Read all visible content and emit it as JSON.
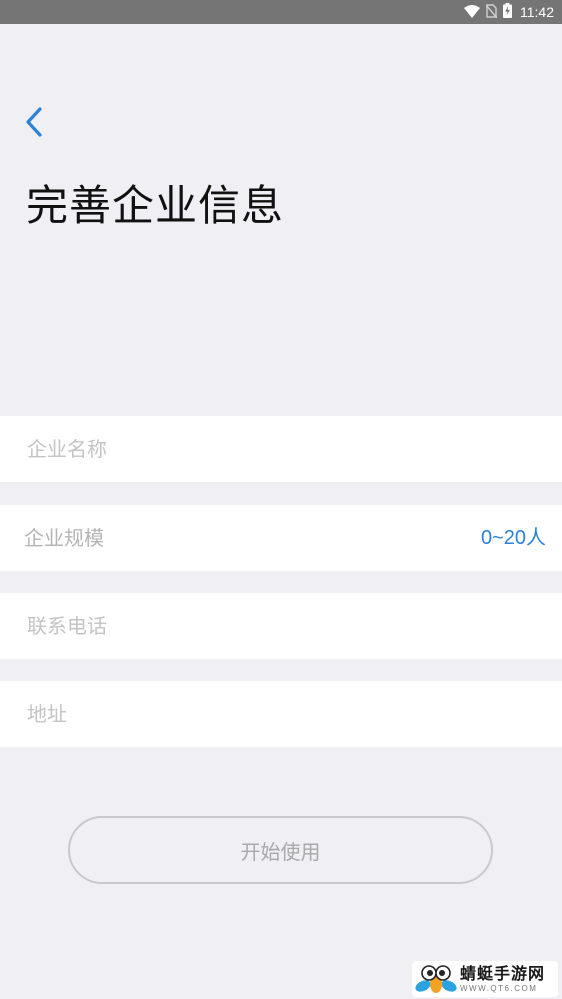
{
  "status_bar": {
    "time": "11:42",
    "icons": [
      "wifi-icon",
      "no-sim-icon",
      "battery-charging-icon"
    ]
  },
  "header": {
    "back_icon": "chevron-left-icon",
    "title": "完善企业信息"
  },
  "form": {
    "company_name": {
      "placeholder": "企业名称",
      "value": ""
    },
    "company_scale": {
      "label": "企业规模",
      "value": "0~20人"
    },
    "contact_phone": {
      "placeholder": "联系电话",
      "value": ""
    },
    "address": {
      "placeholder": "地址",
      "value": ""
    }
  },
  "actions": {
    "start_label": "开始使用"
  },
  "watermark": {
    "name": "蜻蜓手游网",
    "url": "WWW.QT6.COM"
  },
  "colors": {
    "background": "#efeff4",
    "accent": "#2a83d8",
    "status_bar": "#757575"
  }
}
